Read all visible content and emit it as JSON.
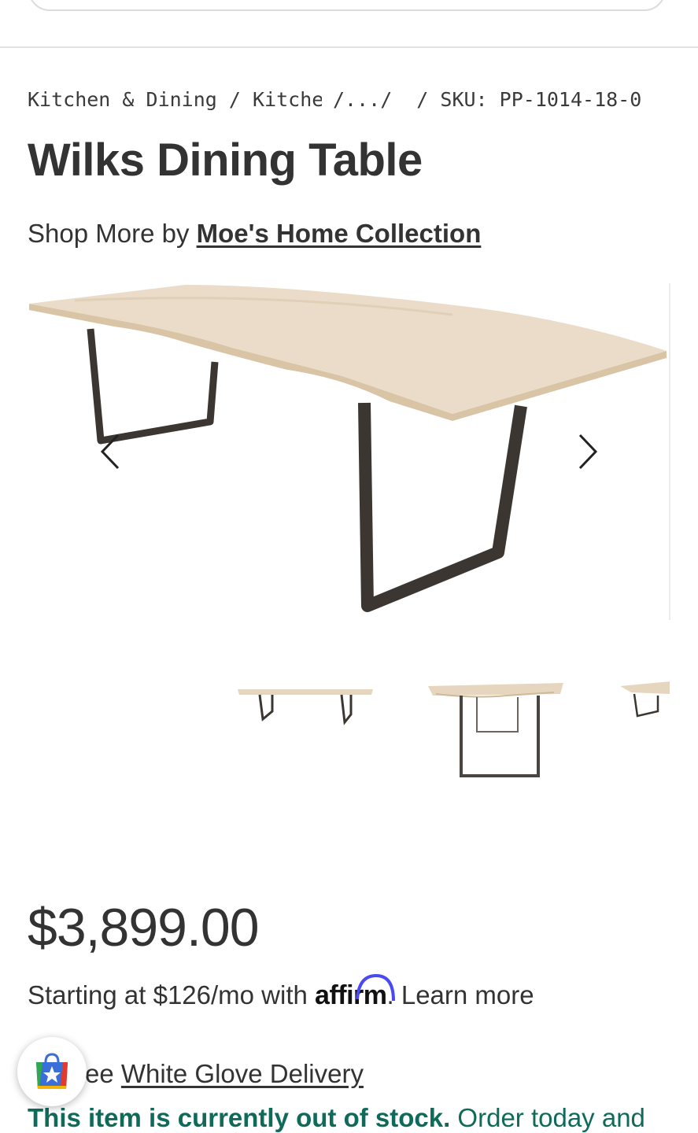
{
  "breadcrumb": {
    "item1": "Kitchen & Dining",
    "sep": " / ",
    "item2": "Kitchen Tables",
    "ellipsis": "/.../",
    "sku_sep": " / ",
    "sku": "SKU: PP-1014-18-0"
  },
  "product": {
    "title": "Wilks Dining Table",
    "shop_more_prefix": "Shop More by ",
    "brand": "Moe's Home Collection"
  },
  "gallery": {
    "prev_icon": "chevron-left-icon",
    "next_icon": "chevron-right-icon"
  },
  "pricing": {
    "price": "$3,899.00",
    "financing_prefix": "Starting at $126/mo with ",
    "affirm_text": "affirm",
    "financing_suffix": ". ",
    "learn_more": "Learn more"
  },
  "delivery": {
    "prefix": "ee ",
    "link": "White Glove Delivery"
  },
  "stock": {
    "bold": "This item is currently out of stock.",
    "rest": " Order today and"
  },
  "colors": {
    "text": "#333333",
    "stock_green": "#0f6a5a",
    "affirm_blue": "#4a4af4",
    "table_top": "#eadcc8",
    "table_legs": "#3b3631"
  },
  "fab": {
    "icon": "shopping-bag-star-icon"
  }
}
